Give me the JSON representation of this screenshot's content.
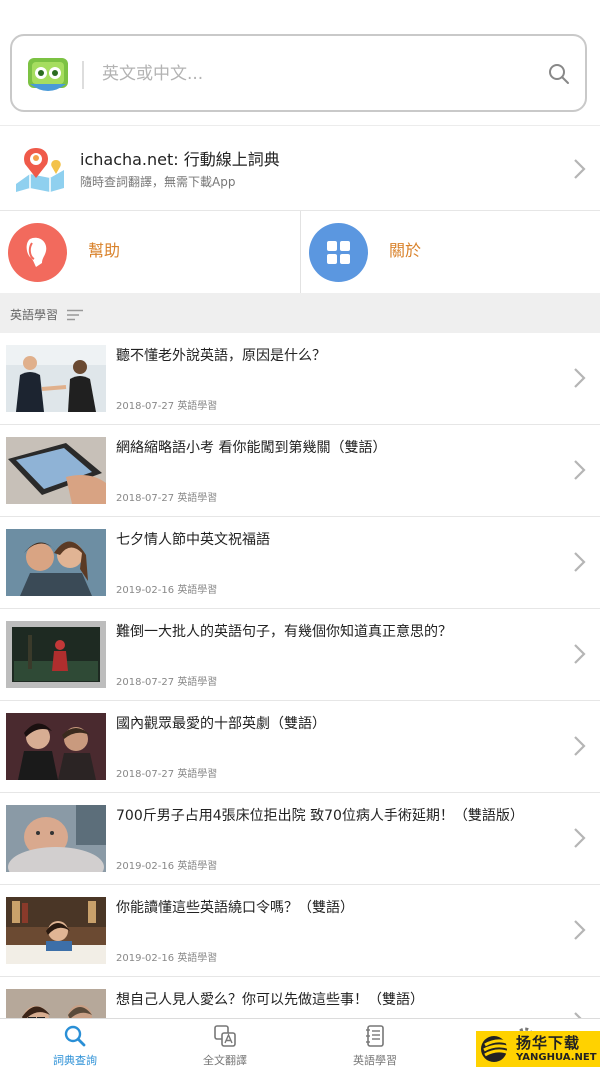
{
  "search": {
    "placeholder": "英文或中文..."
  },
  "promo": {
    "title": "ichacha.net: 行動線上詞典",
    "subtitle": "隨時查詞翻譯，無需下載App"
  },
  "quick": {
    "help": {
      "label": "幫助",
      "color": "#f26a5d"
    },
    "about": {
      "label": "關於",
      "color": "#5b97e0"
    },
    "label_color": "#d9822b"
  },
  "section": {
    "title": "英語學習"
  },
  "articles": [
    {
      "title": "聽不懂老外說英語，原因是什么？",
      "date": "2018-07-27",
      "category": "英語學習"
    },
    {
      "title": "網絡縮略語小考 看你能闖到第幾關（雙語）",
      "date": "2018-07-27",
      "category": "英語學習"
    },
    {
      "title": "七夕情人節中英文祝福語",
      "date": "2019-02-16",
      "category": "英語學習"
    },
    {
      "title": "難倒一大批人的英語句子，有幾個你知道真正意思的？",
      "date": "2018-07-27",
      "category": "英語學習"
    },
    {
      "title": "國內觀眾最愛的十部英劇（雙語）",
      "date": "2018-07-27",
      "category": "英語學習"
    },
    {
      "title": "700斤男子占用4張床位拒出院 致70位病人手術延期！（雙語版）",
      "date": "2019-02-16",
      "category": "英語學習"
    },
    {
      "title": "你能讀懂這些英語繞口令嗎？（雙語）",
      "date": "2019-02-16",
      "category": "英語學習"
    },
    {
      "title": "想自己人見人愛么？你可以先做這些事！（雙語）",
      "date": "",
      "category": ""
    }
  ],
  "tabs": [
    {
      "label": "詞典查詢",
      "icon": "search-icon",
      "active": true
    },
    {
      "label": "全文翻譯",
      "icon": "translate-icon",
      "active": false
    },
    {
      "label": "英語學習",
      "icon": "notebook-icon",
      "active": false
    },
    {
      "label": "",
      "icon": "gear-icon",
      "active": false
    }
  ],
  "watermark": {
    "line1": "扬华下载",
    "line2": "YANGHUA.NET"
  },
  "colors": {
    "accent": "#2a8fd6"
  }
}
